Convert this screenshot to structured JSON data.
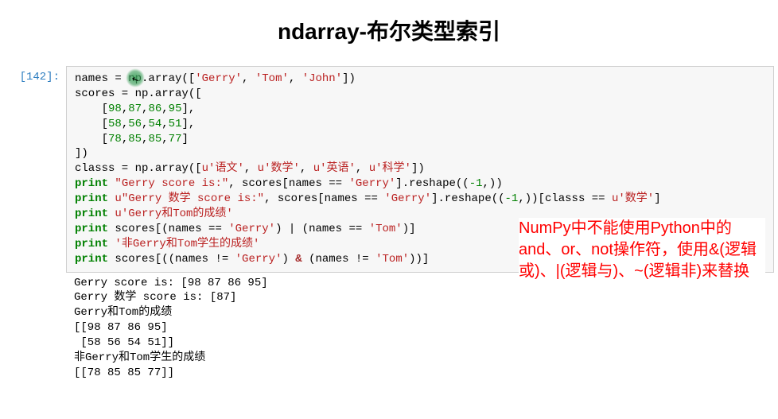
{
  "title": "ndarray-布尔类型索引",
  "prompt_label": "[142]:",
  "code": {
    "line1_a": "names = np.array([",
    "line1_s1": "'Gerry'",
    "line1_s2": "'Tom'",
    "line1_s3": "'John'",
    "line2": "scores = np.array([",
    "row1": [
      "98",
      "87",
      "86",
      "95"
    ],
    "row2": [
      "58",
      "56",
      "54",
      "51"
    ],
    "row3": [
      "78",
      "85",
      "85",
      "77"
    ],
    "line6": "])",
    "line7_a": "classs = np.array([",
    "line7_s1": "u'语文'",
    "line7_s2": "u'数学'",
    "line7_s3": "u'英语'",
    "line7_s4": "u'科学'",
    "print": "print",
    "p1_str": "\"Gerry score is:\"",
    "p1_rest_a": ", scores[names == ",
    "p1_gerry": "'Gerry'",
    "p1_rest_b": "].reshape((",
    "neg1": "-1",
    "p1_rest_c": ",))",
    "p2_str": "u\"Gerry 数学 score is:\"",
    "p2_rest_a": ", scores[names == ",
    "p2_rest_b": "].reshape((",
    "p2_rest_c": ",))[classs == ",
    "p2_subj": "u'数学'",
    "p3_str": "u'Gerry和Tom的成绩'",
    "p4_a": " scores[(names == ",
    "p4_tom": "'Tom'",
    "p4_b": ") | (names == ",
    "p4_c": ")]",
    "p5_str": "'非Gerry和Tom学生的成绩'",
    "p6_a": " scores[((names != ",
    "p6_b": ") & (names != ",
    "p6_c": "))]"
  },
  "output": {
    "l1": "Gerry score is: [98 87 86 95]",
    "l2": "Gerry 数学 score is: [87]",
    "l3": "Gerry和Tom的成绩",
    "l4": "[[98 87 86 95]",
    "l5": " [58 56 54 51]]",
    "l6": "非Gerry和Tom学生的成绩",
    "l7": "[[78 85 85 77]]"
  },
  "annotation": "NumPy中不能使用Python中的and、or、not操作符，使用&(逻辑或)、|(逻辑与)、~(逻辑非)来替换"
}
